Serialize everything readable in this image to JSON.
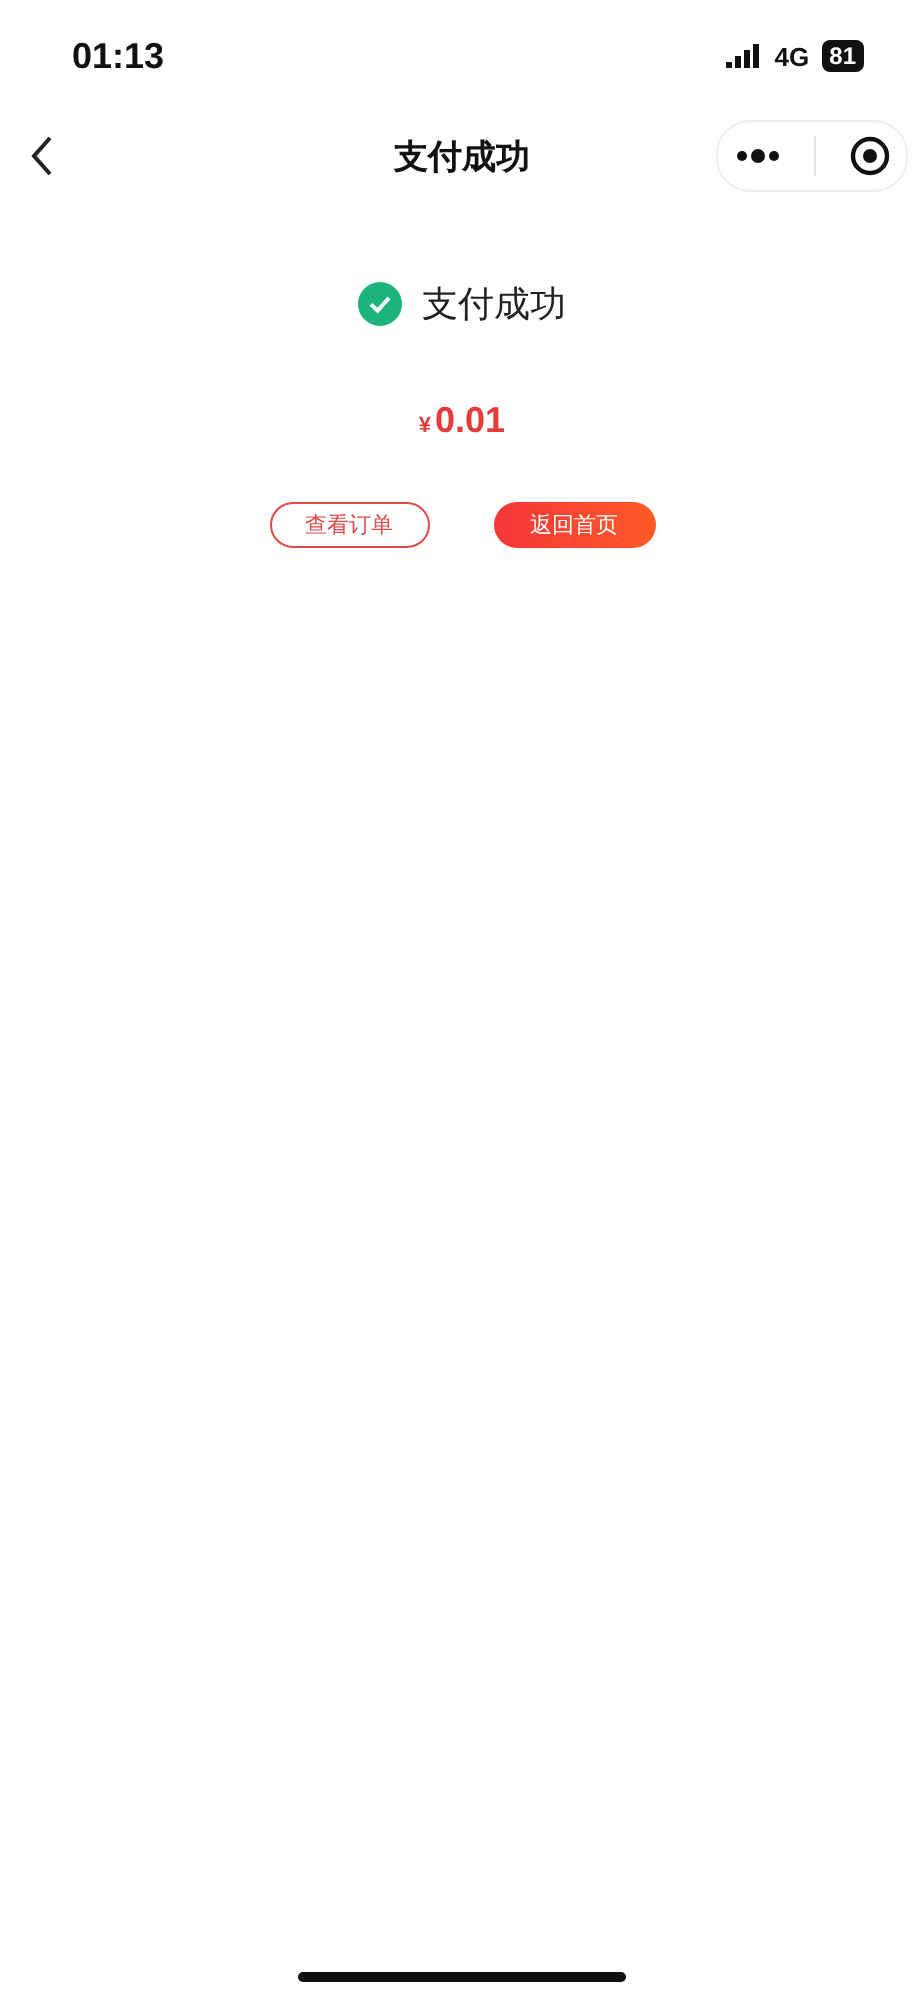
{
  "status_bar": {
    "time": "01:13",
    "network": "4G",
    "battery": "81"
  },
  "nav_bar": {
    "title": "支付成功"
  },
  "result": {
    "message": "支付成功",
    "currency": "¥",
    "amount": "0.01"
  },
  "buttons": [
    {
      "label": "查看订单",
      "kind": "outline"
    },
    {
      "label": "返回首页",
      "kind": "filled"
    }
  ]
}
